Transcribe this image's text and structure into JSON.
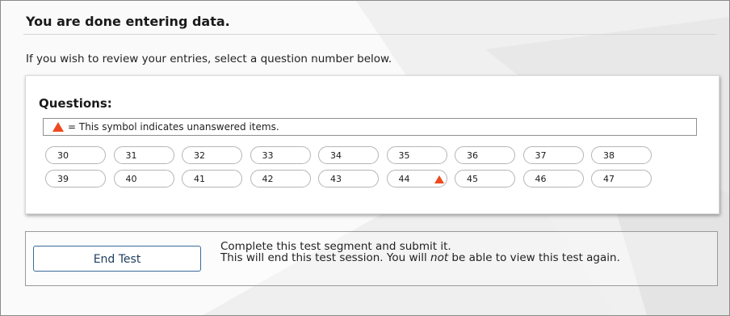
{
  "page": {
    "title": "You are done entering data.",
    "instructions": "If you wish to review your entries, select a question number below."
  },
  "questions_panel": {
    "heading": "Questions:",
    "legend_text": "= This symbol indicates unanswered items.",
    "questions": [
      {
        "number": "30",
        "unanswered": false
      },
      {
        "number": "31",
        "unanswered": false
      },
      {
        "number": "32",
        "unanswered": false
      },
      {
        "number": "33",
        "unanswered": false
      },
      {
        "number": "34",
        "unanswered": false
      },
      {
        "number": "35",
        "unanswered": false
      },
      {
        "number": "36",
        "unanswered": false
      },
      {
        "number": "37",
        "unanswered": false
      },
      {
        "number": "38",
        "unanswered": false
      },
      {
        "number": "39",
        "unanswered": false
      },
      {
        "number": "40",
        "unanswered": false
      },
      {
        "number": "41",
        "unanswered": false
      },
      {
        "number": "42",
        "unanswered": false
      },
      {
        "number": "43",
        "unanswered": false
      },
      {
        "number": "44",
        "unanswered": true
      },
      {
        "number": "45",
        "unanswered": false
      },
      {
        "number": "46",
        "unanswered": false
      },
      {
        "number": "47",
        "unanswered": false
      }
    ]
  },
  "end_test": {
    "button_label": "End Test",
    "line1": "Complete this test segment and submit it.",
    "line2_before": "This will end this test session. You will ",
    "line2_emphasis": "not",
    "line2_after": " be able to view this test again."
  },
  "colors": {
    "warning_triangle": "#ee4a1f",
    "button_border": "#3a6a9a",
    "button_text": "#1e3d5f"
  },
  "icons": {
    "unanswered": "warning-triangle-icon"
  }
}
